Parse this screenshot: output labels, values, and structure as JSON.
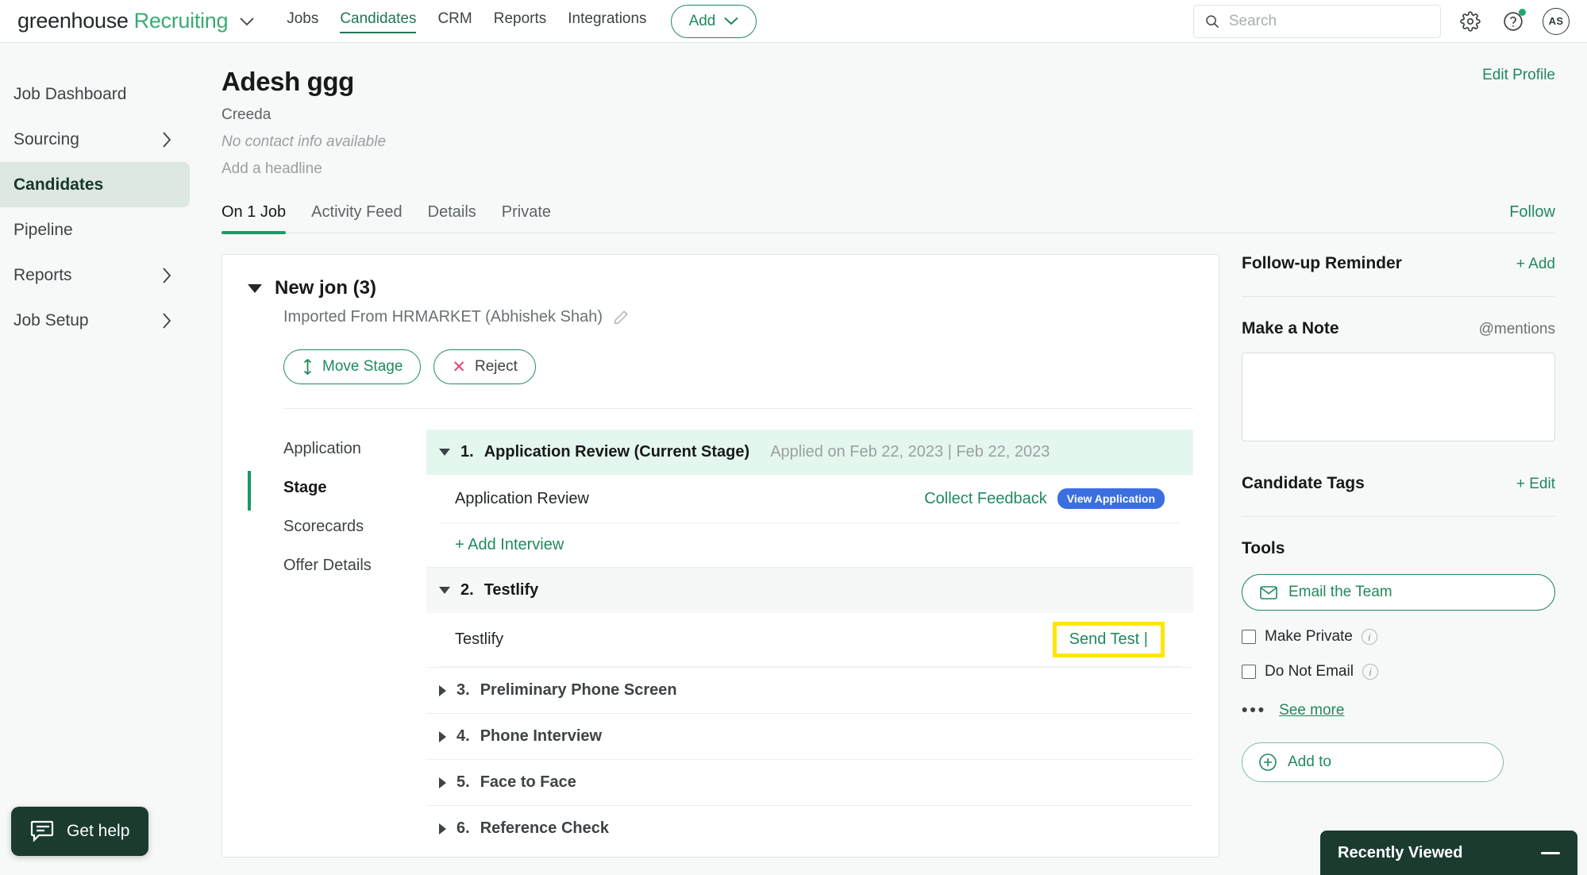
{
  "header": {
    "brand_primary": "greenhouse",
    "brand_secondary": "Recruiting",
    "nav": [
      {
        "label": "Jobs",
        "active": false
      },
      {
        "label": "Candidates",
        "active": true
      },
      {
        "label": "CRM",
        "active": false
      },
      {
        "label": "Reports",
        "active": false
      },
      {
        "label": "Integrations",
        "active": false
      }
    ],
    "add_button": "Add",
    "search_placeholder": "Search",
    "search_value": "",
    "avatar_initials": "AS"
  },
  "sidebar": {
    "items": [
      {
        "label": "Job Dashboard",
        "chevron": false,
        "active": false
      },
      {
        "label": "Sourcing",
        "chevron": true,
        "active": false
      },
      {
        "label": "Candidates",
        "chevron": false,
        "active": true
      },
      {
        "label": "Pipeline",
        "chevron": false,
        "active": false
      },
      {
        "label": "Reports",
        "chevron": true,
        "active": false
      },
      {
        "label": "Job Setup",
        "chevron": true,
        "active": false
      }
    ]
  },
  "candidate": {
    "name": "Adesh ggg",
    "company": "Creeda",
    "contact_info": "No contact info available",
    "headline_placeholder": "Add a headline",
    "edit_profile": "Edit Profile",
    "follow": "Follow",
    "tabs": [
      {
        "label": "On 1 Job",
        "active": true
      },
      {
        "label": "Activity Feed",
        "active": false
      },
      {
        "label": "Details",
        "active": false
      },
      {
        "label": "Private",
        "active": false
      }
    ]
  },
  "job_card": {
    "title": "New jon (3)",
    "source": "Imported From HRMARKET (Abhishek Shah)",
    "move_stage": "Move Stage",
    "reject": "Reject",
    "subnav": [
      {
        "label": "Application",
        "active": false
      },
      {
        "label": "Stage",
        "active": true
      },
      {
        "label": "Scorecards",
        "active": false
      },
      {
        "label": "Offer Details",
        "active": false
      }
    ],
    "stages": [
      {
        "num": "1.",
        "label": "Application Review (Current Stage)",
        "date": "Applied on Feb 22, 2023 | Feb 22, 2023",
        "expanded": true,
        "current": true,
        "interview": "Application Review",
        "collect_feedback": "Collect Feedback",
        "view_application": "View Application",
        "add_interview": "+ Add Interview"
      },
      {
        "num": "2.",
        "label": "Testlify",
        "date": "",
        "expanded": true,
        "current": false,
        "interview": "Testlify",
        "send_test": "Send Test |"
      },
      {
        "num": "3.",
        "label": "Preliminary Phone Screen",
        "expanded": false,
        "current": false
      },
      {
        "num": "4.",
        "label": "Phone Interview",
        "expanded": false,
        "current": false
      },
      {
        "num": "5.",
        "label": "Face to Face",
        "expanded": false,
        "current": false
      },
      {
        "num": "6.",
        "label": "Reference Check",
        "expanded": false,
        "current": false
      }
    ]
  },
  "right_panel": {
    "followup_title": "Follow-up Reminder",
    "followup_action": "+ Add",
    "note_title": "Make a Note",
    "note_mentions": "@mentions",
    "note_value": "",
    "tags_title": "Candidate Tags",
    "tags_action": "+ Edit",
    "tools_title": "Tools",
    "email_team": "Email the Team",
    "make_private": "Make Private",
    "do_not_email": "Do Not Email",
    "see_more": "See more",
    "add_to": "Add to"
  },
  "widgets": {
    "get_help": "Get help",
    "recently_viewed": "Recently Viewed"
  },
  "colors": {
    "brand_green": "#3aab72",
    "link_green": "#1f8a5c",
    "active_tab_green": "#1a9a66",
    "current_stage_bg": "#e4f7ee",
    "badge_blue": "#3b6fe0",
    "highlight_yellow": "#ffe600",
    "reject_x_red": "#e0457b",
    "dark_panel": "#1b3b2f"
  }
}
